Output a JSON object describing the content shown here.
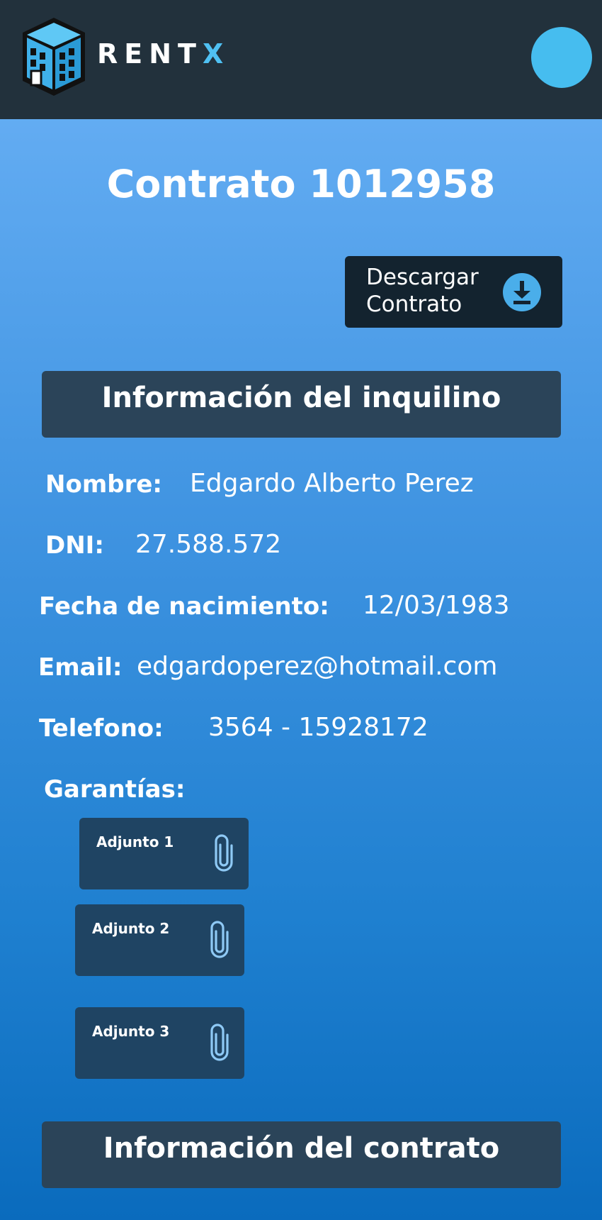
{
  "app": {
    "name_main": "RENT",
    "name_accent": "X",
    "accent_color": "#4fc0f2",
    "header_color": "#22313c"
  },
  "header": {
    "avatar_icon": "user-avatar"
  },
  "page": {
    "title": "Contrato 1012958"
  },
  "download": {
    "label": "Descargar\nContrato",
    "icon": "download-icon"
  },
  "tenant_section": {
    "title": "Información del inquilino",
    "fields": {
      "name": {
        "label": "Nombre:",
        "value": "Edgardo Alberto Perez"
      },
      "dni": {
        "label": "DNI:",
        "value": "27.588.572"
      },
      "birthdate": {
        "label": "Fecha de nacimiento:",
        "value": "12/03/1983"
      },
      "email": {
        "label": "Email:",
        "value": "edgardoperez@hotmail.com"
      },
      "phone": {
        "label": "Telefono:",
        "value": "3564 - 15928172"
      }
    },
    "guarantees_label": "Garantías:",
    "attachments": [
      {
        "label": "Adjunto 1",
        "icon": "paperclip-icon"
      },
      {
        "label": "Adjunto 2",
        "icon": "paperclip-icon"
      },
      {
        "label": "Adjunto 3",
        "icon": "paperclip-icon"
      }
    ]
  },
  "contract_section": {
    "title": "Información del contrato"
  }
}
